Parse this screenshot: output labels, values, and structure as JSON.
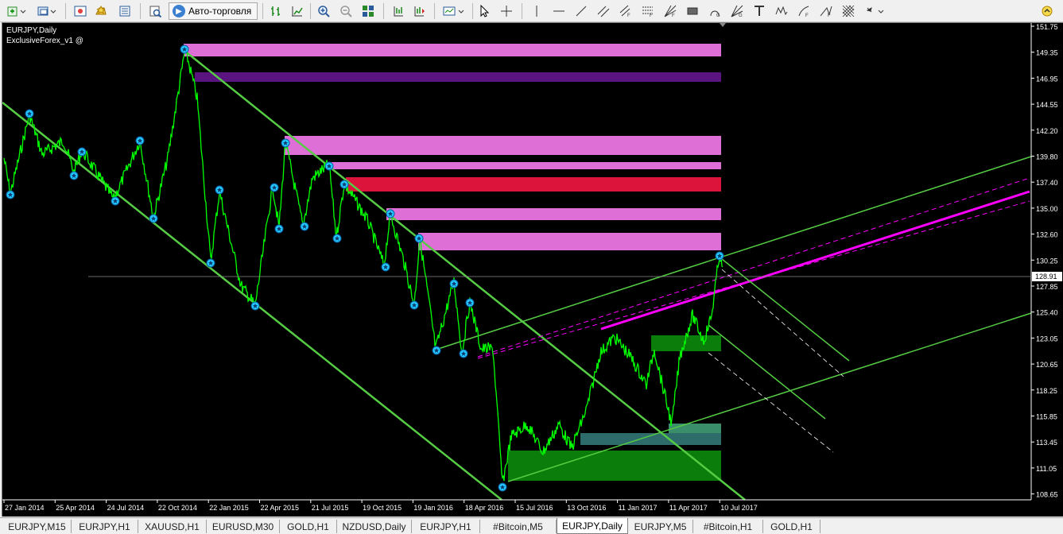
{
  "chart": {
    "symbol_title": "EURJPY,Daily",
    "indicator_label": "ExclusiveForex_v1 @",
    "current_price": "128.91",
    "price_ticks": [
      "151.75",
      "149.35",
      "146.95",
      "144.55",
      "142.20",
      "139.80",
      "137.40",
      "135.00",
      "132.60",
      "130.25",
      "127.85",
      "125.40",
      "123.05",
      "120.65",
      "118.25",
      "115.85",
      "113.45",
      "111.05",
      "108.65"
    ],
    "time_ticks": [
      "27 Jan 2014",
      "25 Apr 2014",
      "24 Jul 2014",
      "22 Oct 2014",
      "22 Jan 2015",
      "22 Apr 2015",
      "21 Jul 2015",
      "19 Oct 2015",
      "19 Jan 2016",
      "18 Apr 2016",
      "15 Jul 2016",
      "13 Oct 2016",
      "11 Jan 2017",
      "11 Apr 2017",
      "10 Jul 2017"
    ],
    "colors": {
      "background": "#000000",
      "price_line": "#00ff00",
      "channel": "#55cc44",
      "zone_pink": "#dd6fd6",
      "zone_purple": "#5a1480",
      "zone_red": "#dc143c",
      "zone_green": "#0a7d0a",
      "regression": "#ff00ff",
      "marker": "#22c8ff"
    }
  },
  "toolbar": {
    "autotrade_label": "Авто-торговля",
    "icons": [
      "new-chart-icon",
      "profiles-icon",
      "market-watch-icon",
      "navigator-icon",
      "terminal-icon",
      "strategy-tester-icon",
      "bar-chart-icon",
      "candles-icon",
      "line-chart-icon",
      "zoom-in-icon",
      "zoom-out-icon",
      "tile-windows-icon",
      "auto-scroll-icon",
      "chart-shift-icon",
      "periods-icon",
      "templates-icon",
      "cursor-icon",
      "crosshair-icon",
      "vertical-line-icon",
      "horizontal-line-icon",
      "trend-line-icon",
      "equidistant-channel-icon",
      "std-deviation-channel-icon",
      "fibonacci-icon",
      "rectangle-icon",
      "text-icon",
      "label-icon",
      "gann-icon",
      "arrows-icon",
      "cycle-lines-icon",
      "more-tools-icon"
    ]
  },
  "tabs": [
    "EURJPY,M15",
    "EURJPY,H1",
    "XAUUSD,H1",
    "EURUSD,M30",
    "GOLD,H1",
    "NZDUSD,Daily",
    "EURJPY,H1",
    "#Bitcoin,M5",
    "EURJPY,Daily",
    "EURJPY,M5",
    "#Bitcoin,H1",
    "GOLD,H1"
  ],
  "active_tab": "EURJPY,Daily"
}
